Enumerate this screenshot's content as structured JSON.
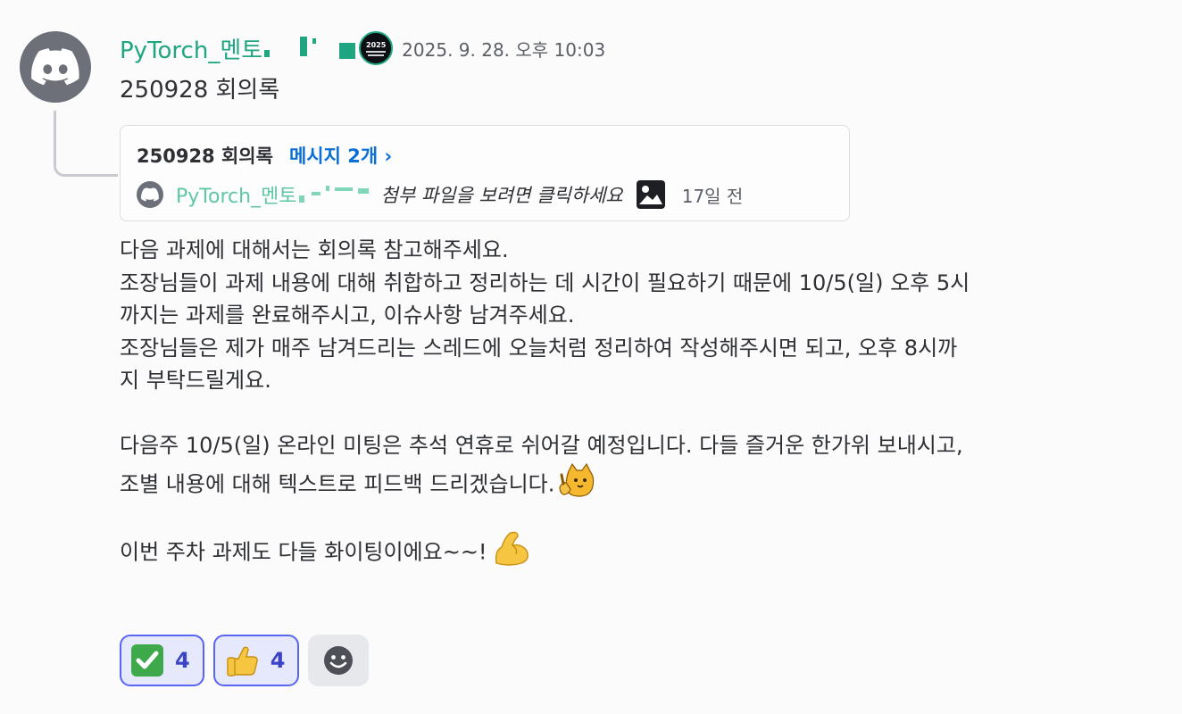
{
  "message": {
    "avatar_icon": "discord-icon",
    "author": "PyTorch_멘토",
    "role_badge": {
      "text": "2025",
      "icon": "community-badge-icon"
    },
    "timestamp": "2025. 9. 28. 오후 10:03",
    "content_title": "250928 회의록"
  },
  "thread_card": {
    "title": "250928 회의록",
    "link_label": "메시지 2개 ›",
    "author_icon": "discord-icon",
    "author": "PyTorch_멘토",
    "preview": "첨부 파일을 보려면 클릭하세요",
    "preview_icon": "image-icon",
    "time": "17일 전"
  },
  "body": {
    "lines": [
      "다음 과제에 대해서는 회의록 참고해주세요.",
      "조장님들이 과제 내용에 대해 취합하고 정리하는 데 시간이 필요하기 때문에 10/5(일) 오후 5시",
      "까지는 과제를 완료해주시고, 이슈사항 남겨주세요.",
      "조장님들은 제가 매주 남겨드리는 스레드에 오늘처럼 정리하여 작성해주시면 되고, 오후 8시까",
      "지 부탁드릴게요.",
      "",
      "다음주 10/5(일) 온라인 미팅은 추석 연휴로 쉬어갈 예정입니다. 다들 즐거운 한가위 보내시고,",
      "조별 내용에 대해 텍스트로 피드백 드리겠습니다.",
      "",
      "이번 주차 과제도 다들 화이팅이에요~~!"
    ],
    "emoji_line7": "cat-pointing-emoji",
    "emoji_line9": "flexed-biceps-emoji"
  },
  "reactions": [
    {
      "icon": "check-mark-emoji",
      "count": "4"
    },
    {
      "icon": "thumbs-up-emoji",
      "count": "4"
    }
  ],
  "add_reaction_icon": "smiley-add-icon",
  "colors": {
    "author": "#1fa580",
    "link": "#0a6fd6",
    "reaction_border": "#5865f2",
    "reaction_count": "#3b44c4"
  }
}
